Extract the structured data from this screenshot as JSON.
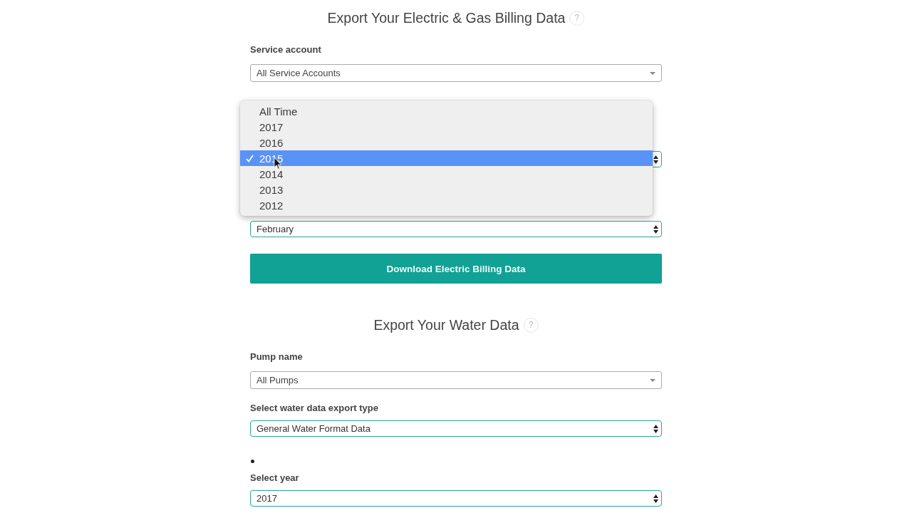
{
  "sections": [
    {
      "title": "Export Your Electric & Gas Billing Data",
      "help": "?",
      "fields": [
        {
          "kind": "dropdown",
          "label": "Service account",
          "value": "All Service Accounts"
        },
        {
          "kind": "select",
          "expanded": true,
          "options": [
            {
              "label": "All Time",
              "selected": false
            },
            {
              "label": "2017",
              "selected": false
            },
            {
              "label": "2016",
              "selected": false
            },
            {
              "label": "2015",
              "selected": true
            },
            {
              "label": "2014",
              "selected": false
            },
            {
              "label": "2013",
              "selected": false
            },
            {
              "label": "2012",
              "selected": false
            }
          ]
        },
        {
          "kind": "select",
          "expanded": false,
          "value": "February"
        }
      ],
      "button": "Download Electric Billing Data"
    },
    {
      "title": "Export Your Water Data",
      "help": "?",
      "fields": [
        {
          "kind": "dropdown",
          "label": "Pump name",
          "value": "All Pumps"
        },
        {
          "kind": "select",
          "expanded": false,
          "label": "Select water data export type",
          "value": "General Water Format Data"
        },
        {
          "kind": "bullet"
        },
        {
          "kind": "select",
          "expanded": false,
          "label": "Select year",
          "value": "2017"
        }
      ]
    }
  ]
}
